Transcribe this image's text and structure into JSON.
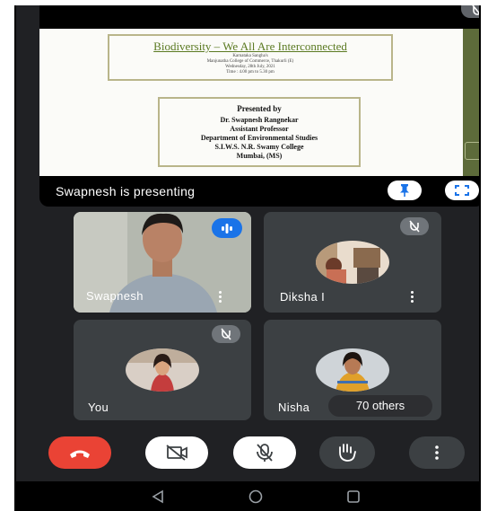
{
  "presentation": {
    "slide_title": "Biodiversity – We All Are Interconnected",
    "host_lines": [
      "Karnataka Sangha's",
      "Manjunatha College of Commerce, Thakurli (E)",
      "Wednesday, 28th July, 2021",
      "Time : 4.00 pm to 5.30 pm"
    ],
    "presented_by": "Presented by",
    "presenter_lines": [
      "Dr. Swapnesh Rangnekar",
      "Assistant Professor",
      "Department of Environmental Studies",
      "S.I.W.S. N.R. Swamy College",
      "Mumbai, (MS)"
    ],
    "status": "Swapnesh is presenting"
  },
  "participants": [
    {
      "name": "Swapnesh",
      "state": "speaking"
    },
    {
      "name": "Diksha I",
      "state": "muted"
    },
    {
      "name": "You",
      "state": "muted"
    },
    {
      "name": "Nisha",
      "state": "muted"
    }
  ],
  "others_label": "70 others",
  "controls": [
    "end-call",
    "camera-off",
    "mic-off",
    "raise-hand",
    "more-options"
  ],
  "system_nav": [
    "back",
    "home",
    "recents"
  ],
  "colors": {
    "background": "#202124",
    "tile": "#3c4043",
    "end_call": "#ea4335",
    "accent": "#1a73e8"
  }
}
